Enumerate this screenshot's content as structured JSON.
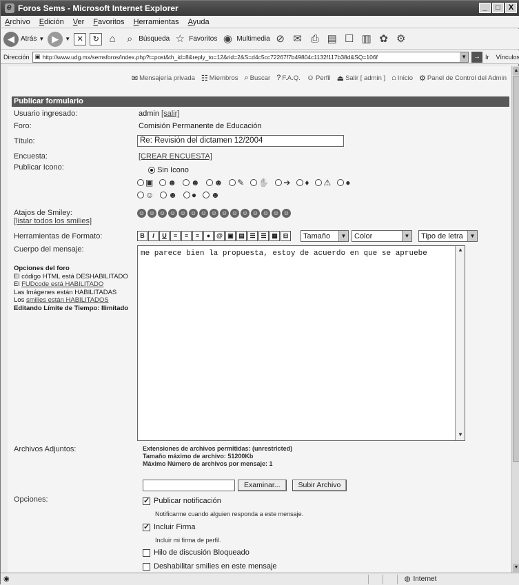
{
  "window": {
    "title": "Foros Sems - Microsoft Internet Explorer",
    "controls": [
      "_",
      "□",
      "X"
    ]
  },
  "menu": [
    "Archivo",
    "Edición",
    "Ver",
    "Favoritos",
    "Herramientas",
    "Ayuda"
  ],
  "toolbar": {
    "back": "Atrás",
    "search": "Búsqueda",
    "favorites": "Favoritos",
    "media": "Multimedia"
  },
  "address": {
    "label": "Dirección",
    "url": "http://www.udg.mx/semsforos/index.php?t=post&th_id=8&reply_to=12&rid=2&S=d4c5cc72267f7b49804c1132f117b38d&SQ=106f",
    "go": "Ir",
    "links": "Vínculos"
  },
  "topnav": [
    {
      "label": "Mensajería privada",
      "icon": "mail-icon"
    },
    {
      "label": "Miembros",
      "icon": "members-icon"
    },
    {
      "label": "Buscar",
      "icon": "search-icon"
    },
    {
      "label": "F.A.Q.",
      "icon": "faq-icon"
    },
    {
      "label": "Perfil",
      "icon": "profile-icon"
    },
    {
      "label": "Salir [ admin ]",
      "icon": "logout-icon"
    },
    {
      "label": "Inicio",
      "icon": "home-icon"
    },
    {
      "label": "Panel de Control del Admin",
      "icon": "admin-icon"
    }
  ],
  "form": {
    "header": "Publicar formulario",
    "usuario_label": "Usuario ingresado:",
    "usuario_value": "admin",
    "salir_link": "[salir]",
    "foro_label": "Foro:",
    "foro_value": "Comisión Permanente de Educación",
    "titulo_label": "Título:",
    "titulo_value": "Re: Revisión del dictamen 12/2004",
    "encuesta_label": "Encuesta:",
    "encuesta_link": "[CREAR ENCUESTA]",
    "icono_label": "Publicar Icono:",
    "sin_icono": "Sin Icono",
    "smiley_label": "Atajos de Smiley:",
    "smiley_link": "[listar todos los smilies]",
    "formato_label": "Herramientas de Formato:",
    "format_buttons": [
      "B",
      "I",
      "U",
      "≡",
      "≡",
      "≡",
      "●",
      "@",
      "▣",
      "▤",
      "☰",
      "☰",
      "▦",
      "⊟"
    ],
    "tamano": "Tamaño",
    "color": "Color",
    "tipo_letra": "Tipo de letra",
    "cuerpo_label": "Cuerpo del mensaje:",
    "cuerpo_value": "me parece bien la propuesta, estoy de acuerdo en que se apruebe",
    "opciones_foro": {
      "title": "Opciones del foro",
      "line1": "El código HTML está DESHABILITADO",
      "line2_a": "El ",
      "line2_link": "FUDcode está HABILITADO",
      "line3": "Las Imágenes están HABILITADAS",
      "line4_a": "Los ",
      "line4_link": "smilies están HABILITADOS",
      "line5": "Editando Límite de Tiempo: Ilimitado"
    },
    "adjuntos_label": "Archivos Adjuntos:",
    "adjuntos_line1": "Extensiones de archivos permitidas: (unrestricted)",
    "adjuntos_line2": "Tamaño máximo de archivo: 51200Kb",
    "adjuntos_line3": "Máximo Número de archivos por mensaje: 1",
    "examinar": "Examinar...",
    "subir": "Subir Archivo",
    "opciones_label": "Opciones:",
    "opt1": "Publicar notificación",
    "opt1_sub": "Notificarme cuando alguien responda a este mensaje.",
    "opt2": "Incluir Firma",
    "opt2_sub": "Incluir mi firma de perfil.",
    "opt3": "Hilo de discusión Bloqueado",
    "opt4": "Deshabilitar smilies en este mensaje"
  },
  "status": {
    "zone": "Internet"
  }
}
